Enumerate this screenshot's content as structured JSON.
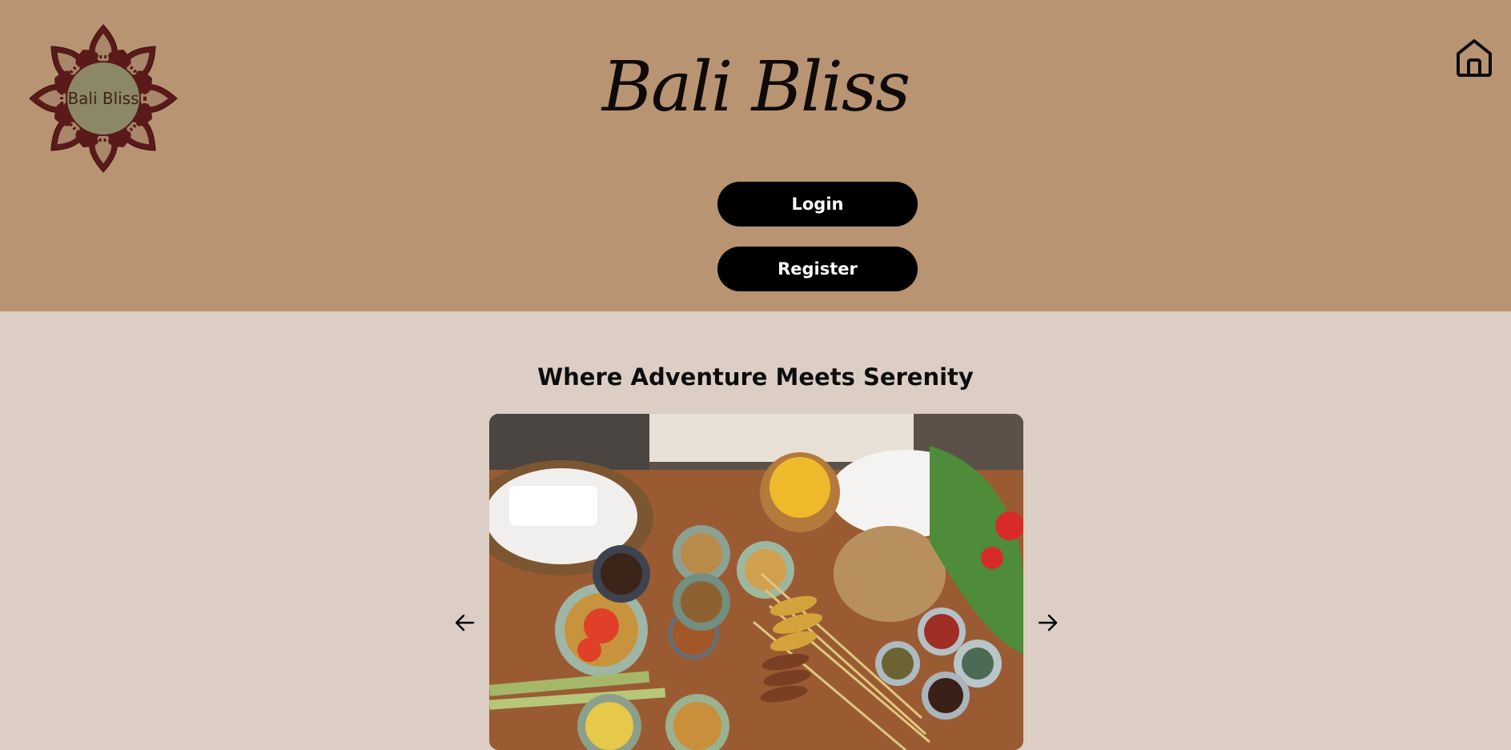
{
  "header": {
    "logo_text": "Bali Bliss",
    "site_title": "Bali Bliss",
    "home_icon": "home-icon",
    "background_color": "#b89472"
  },
  "auth": {
    "login_label": "Login",
    "register_label": "Register"
  },
  "hero": {
    "tagline": "Where Adventure Meets Serenity",
    "prev_icon": "arrow-left-icon",
    "next_icon": "arrow-right-icon",
    "background_color": "#dccdc5"
  }
}
